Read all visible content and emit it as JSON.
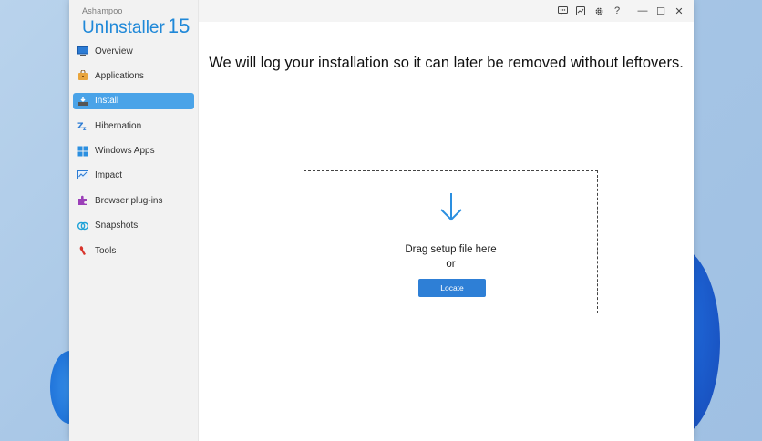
{
  "app": {
    "brand_small": "Ashampoo",
    "brand_name": "UnInstaller",
    "brand_version": "15"
  },
  "sidebar": {
    "items": [
      {
        "label": "Overview",
        "icon": "overview-icon",
        "active": false
      },
      {
        "label": "Applications",
        "icon": "applications-icon",
        "active": false
      },
      {
        "label": "Install",
        "icon": "install-icon",
        "active": true
      },
      {
        "label": "Hibernation",
        "icon": "hibernation-icon",
        "active": false
      },
      {
        "label": "Windows Apps",
        "icon": "windows-apps-icon",
        "active": false
      },
      {
        "label": "Impact",
        "icon": "impact-icon",
        "active": false
      },
      {
        "label": "Browser plug-ins",
        "icon": "browser-plugins-icon",
        "active": false
      },
      {
        "label": "Snapshots",
        "icon": "snapshots-icon",
        "active": false
      },
      {
        "label": "Tools",
        "icon": "tools-icon",
        "active": false
      }
    ]
  },
  "titlebar": {
    "help_label": "?",
    "minimize_label": "—",
    "maximize_label": "☐",
    "close_label": "✕",
    "icons": [
      "feedback-icon",
      "news-icon",
      "settings-icon",
      "help-icon"
    ]
  },
  "main": {
    "headline": "We will log your installation so it can later be removed without leftovers.",
    "drop_text_line1": "Drag setup file here",
    "drop_text_line2": "or",
    "locate_label": "Locate"
  },
  "colors": {
    "accent": "#1f88d8",
    "active_nav": "#4aa3e8",
    "button": "#2e7fd6"
  }
}
